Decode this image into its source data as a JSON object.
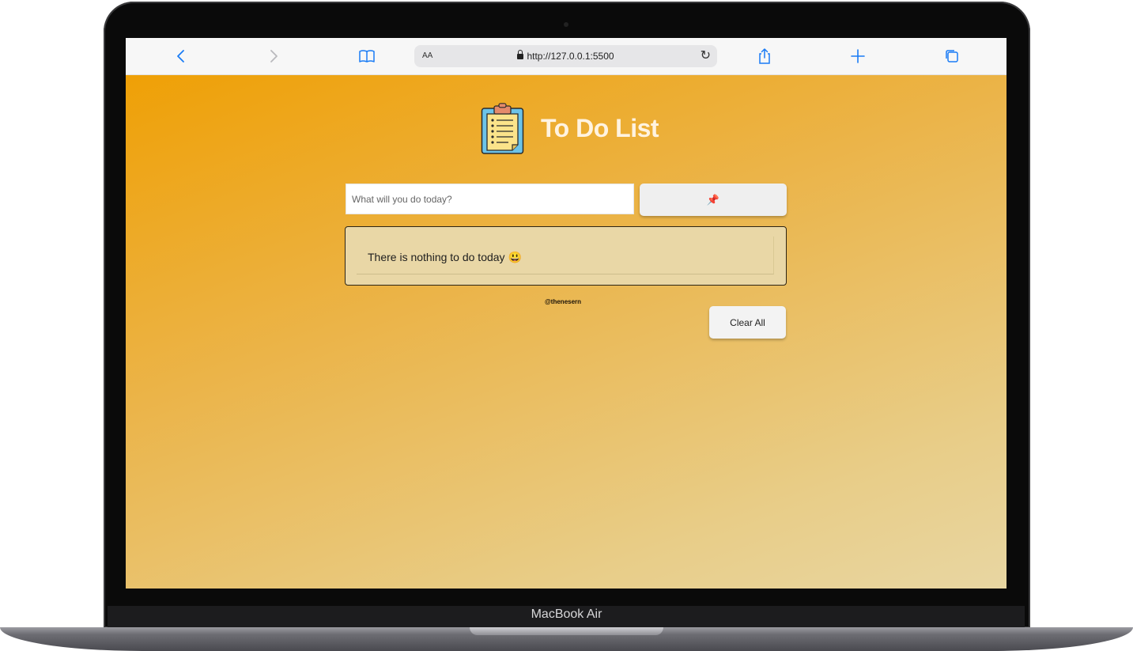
{
  "device": {
    "brand_label": "MacBook Air"
  },
  "browser": {
    "text_size_label": "AA",
    "url": "http://127.0.0.1:5500",
    "icons": {
      "back": "chevron-left-icon",
      "forward": "chevron-right-icon",
      "bookmarks": "book-icon",
      "reload": "reload-icon",
      "share": "share-icon",
      "new_tab": "plus-icon",
      "tabs": "tabs-icon"
    },
    "accent_color": "#1a7cf5"
  },
  "app": {
    "title": "To Do List",
    "logo_icon": "clipboard-icon",
    "input": {
      "value": "",
      "placeholder": "What will you do today?"
    },
    "add_button": {
      "icon": "pushpin-icon",
      "glyph": "📌"
    },
    "list": {
      "items": [
        {
          "text": "There is nothing to do today 😃"
        }
      ]
    },
    "credit": "@thenesern",
    "clear_button_label": "Clear All",
    "colors": {
      "background_start": "#efa006",
      "background_end": "#e8d6a2",
      "list_background": "#e9d7a6",
      "title": "#fff3e0"
    }
  }
}
